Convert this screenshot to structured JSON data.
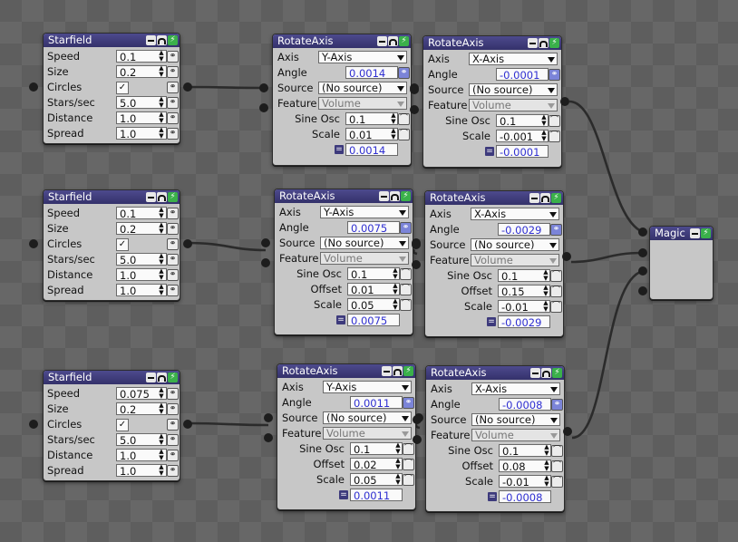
{
  "starfields": [
    {
      "title": "Starfield",
      "speed": "0.1",
      "size": "0.2",
      "circles": "✓",
      "stars": "5.0",
      "distance": "1.0",
      "spread": "1.0"
    },
    {
      "title": "Starfield",
      "speed": "0.1",
      "size": "0.2",
      "circles": "✓",
      "stars": "5.0",
      "distance": "1.0",
      "spread": "1.0"
    },
    {
      "title": "Starfield",
      "speed": "0.075",
      "size": "0.2",
      "circles": "✓",
      "stars": "5.0",
      "distance": "1.0",
      "spread": "1.0"
    }
  ],
  "starfield_labels": {
    "speed": "Speed",
    "size": "Size",
    "circles": "Circles",
    "stars": "Stars/sec",
    "distance": "Distance",
    "spread": "Spread"
  },
  "rotate_labels": {
    "axis": "Axis",
    "angle": "Angle",
    "source": "Source",
    "feature": "Feature",
    "sine": "Sine Osc",
    "offset": "Offset",
    "scale": "Scale"
  },
  "rotates": [
    {
      "title": "RotateAxis",
      "axis": "Y-Axis",
      "angle": "0.0014",
      "source": "(No source)",
      "feature": "Volume",
      "sine": "0.1",
      "scale": "0.01",
      "result": "0.0014"
    },
    {
      "title": "RotateAxis",
      "axis": "X-Axis",
      "angle": "-0.0001",
      "source": "(No source)",
      "feature": "Volume",
      "sine": "0.1",
      "scale": "-0.001",
      "result": "-0.0001"
    },
    {
      "title": "RotateAxis",
      "axis": "Y-Axis",
      "angle": "0.0075",
      "source": "(No source)",
      "feature": "Volume",
      "sine": "0.1",
      "offset": "0.01",
      "scale": "0.05",
      "result": "0.0075"
    },
    {
      "title": "RotateAxis",
      "axis": "X-Axis",
      "angle": "-0.0029",
      "source": "(No source)",
      "feature": "Volume",
      "sine": "0.1",
      "offset": "0.15",
      "scale": "-0.01",
      "result": "-0.0029"
    },
    {
      "title": "RotateAxis",
      "axis": "Y-Axis",
      "angle": "0.0011",
      "source": "(No source)",
      "feature": "Volume",
      "sine": "0.1",
      "offset": "0.02",
      "scale": "0.05",
      "result": "0.0011"
    },
    {
      "title": "RotateAxis",
      "axis": "X-Axis",
      "angle": "-0.0008",
      "source": "(No source)",
      "feature": "Volume",
      "sine": "0.1",
      "offset": "0.08",
      "scale": "-0.01",
      "result": "-0.0008"
    }
  ],
  "magic": {
    "title": "Magic"
  },
  "icons": {
    "minimize": "minimize-icon",
    "display": "display-toggle-icon",
    "power": "power-icon",
    "link": "link-icon",
    "oscillator": "oscillator-icon",
    "spinner": "spinner-icon",
    "dropdown": "dropdown-arrow-icon",
    "equals": "equals-icon"
  },
  "colors": {
    "titlebar": "#3e3b7a",
    "panel": "#c7c7c7",
    "accent_value": "#2f2fd1",
    "power": "#3ab04a",
    "canvas": "#5e5e5e"
  }
}
